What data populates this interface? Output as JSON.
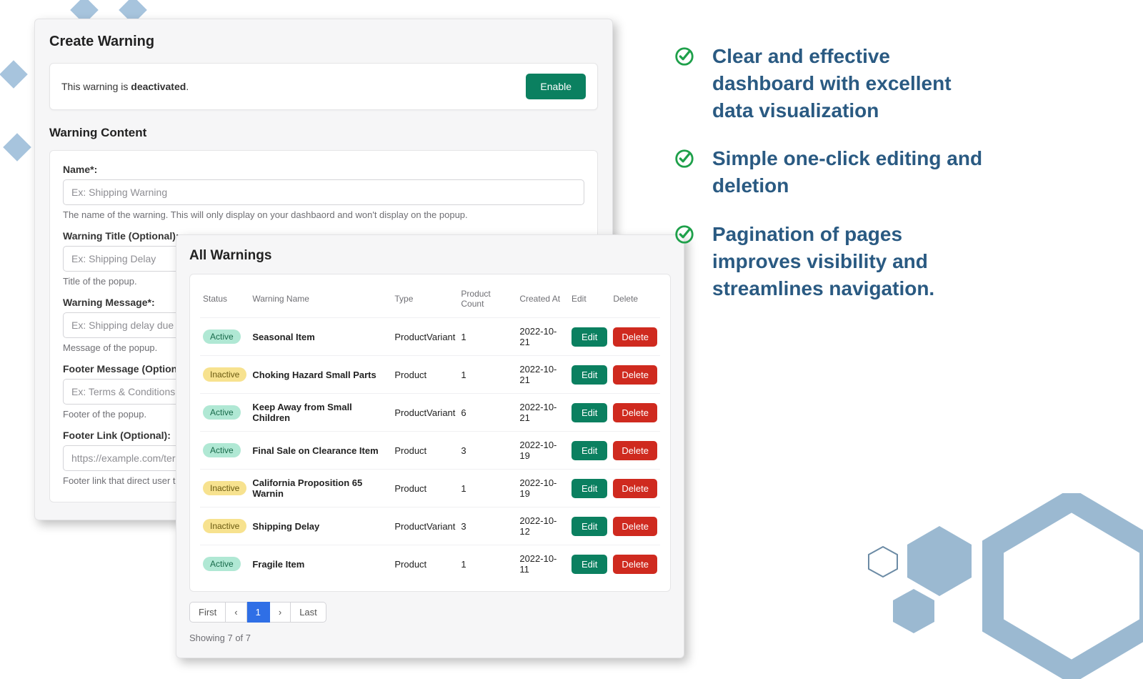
{
  "create_warning": {
    "title": "Create Warning",
    "status_prefix": "This warning is ",
    "status_word": "deactivated",
    "status_suffix": ".",
    "enable_label": "Enable",
    "content_section_title": "Warning Content",
    "fields": {
      "name": {
        "label": "Name*:",
        "placeholder": "Ex: Shipping Warning",
        "help": "The name of the warning. This will only display on your dashbaord and won't display on the popup."
      },
      "title": {
        "label": "Warning Title (Optional):",
        "placeholder": "Ex: Shipping Delay",
        "help": "Title of the popup."
      },
      "message": {
        "label": "Warning Message*:",
        "placeholder": "Ex: Shipping delay due to h",
        "help": "Message of the popup."
      },
      "footer_msg": {
        "label": "Footer Message (Optional)",
        "placeholder": "Ex: Terms & Conditions",
        "help": "Footer of the popup."
      },
      "footer_link": {
        "label": "Footer Link (Optional):",
        "placeholder": "https://example.com/terms",
        "help": "Footer link that direct user to"
      }
    }
  },
  "all_warnings": {
    "title": "All Warnings",
    "columns": {
      "status": "Status",
      "name": "Warning Name",
      "type": "Type",
      "count": "Product Count",
      "created": "Created At",
      "edit": "Edit",
      "del": "Delete"
    },
    "edit_label": "Edit",
    "delete_label": "Delete",
    "rows": [
      {
        "status": "Active",
        "name": "Seasonal Item",
        "type": "ProductVariant",
        "count": "1",
        "created": "2022-10-21"
      },
      {
        "status": "Inactive",
        "name": "Choking Hazard Small Parts",
        "type": "Product",
        "count": "1",
        "created": "2022-10-21"
      },
      {
        "status": "Active",
        "name": "Keep Away from Small Children",
        "type": "ProductVariant",
        "count": "6",
        "created": "2022-10-21"
      },
      {
        "status": "Active",
        "name": "Final Sale on Clearance Item",
        "type": "Product",
        "count": "3",
        "created": "2022-10-19"
      },
      {
        "status": "Inactive",
        "name": "California Proposition 65 Warnin",
        "type": "Product",
        "count": "1",
        "created": "2022-10-19"
      },
      {
        "status": "Inactive",
        "name": "Shipping Delay",
        "type": "ProductVariant",
        "count": "3",
        "created": "2022-10-12"
      },
      {
        "status": "Active",
        "name": "Fragile Item",
        "type": "Product",
        "count": "1",
        "created": "2022-10-11"
      }
    ],
    "pager": {
      "first": "First",
      "prev": "‹",
      "page": "1",
      "next": "›",
      "last": "Last"
    },
    "showing": "Showing 7 of 7"
  },
  "features": {
    "items": [
      "Clear and effective dashboard with excellent data visualization",
      "Simple one-click editing and deletion",
      "Pagination of pages improves visibility and streamlines navigation."
    ]
  }
}
